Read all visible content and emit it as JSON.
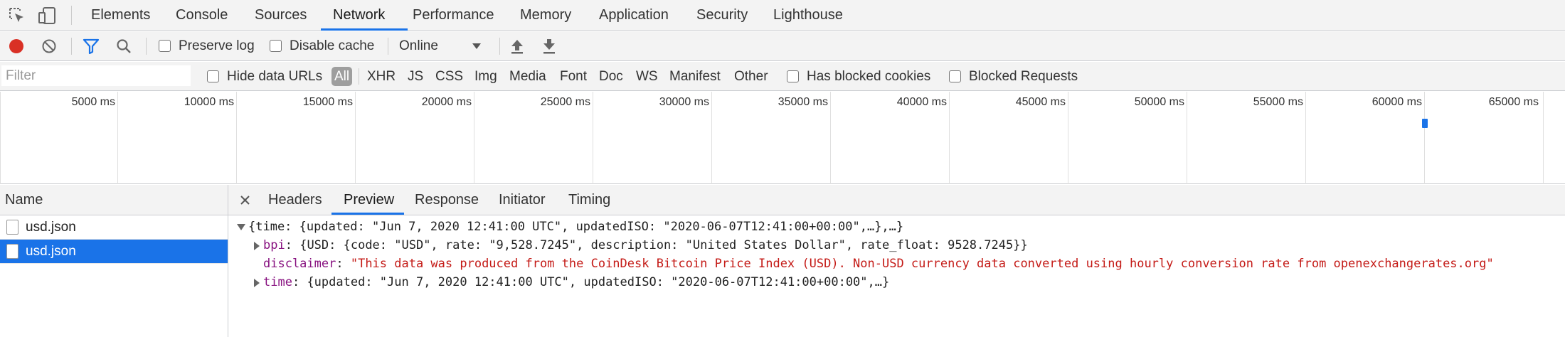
{
  "main_tabs": [
    "Elements",
    "Console",
    "Sources",
    "Network",
    "Performance",
    "Memory",
    "Application",
    "Security",
    "Lighthouse"
  ],
  "active_main_tab": "Network",
  "toolbar": {
    "preserve_log": "Preserve log",
    "disable_cache": "Disable cache",
    "throttling": "Online"
  },
  "filter": {
    "placeholder": "Filter",
    "hide_data_urls": "Hide data URLs",
    "types": [
      "All",
      "XHR",
      "JS",
      "CSS",
      "Img",
      "Media",
      "Font",
      "Doc",
      "WS",
      "Manifest",
      "Other"
    ],
    "active_type": "All",
    "has_blocked_cookies": "Has blocked cookies",
    "blocked_requests": "Blocked Requests"
  },
  "timeline": {
    "ticks": [
      "5000 ms",
      "10000 ms",
      "15000 ms",
      "20000 ms",
      "25000 ms",
      "30000 ms",
      "35000 ms",
      "40000 ms",
      "45000 ms",
      "50000 ms",
      "55000 ms",
      "60000 ms",
      "65000 ms"
    ]
  },
  "requests": {
    "header": "Name",
    "rows": [
      "usd.json",
      "usd.json"
    ],
    "selected_index": 1
  },
  "detail_tabs": [
    "Headers",
    "Preview",
    "Response",
    "Initiator",
    "Timing"
  ],
  "active_detail_tab": "Preview",
  "preview": {
    "root": "{time: {updated: \"Jun 7, 2020 12:41:00 UTC\", updatedISO: \"2020-06-07T12:41:00+00:00\",…},…}",
    "bpi_key": "bpi",
    "bpi_value": "{USD: {code: \"USD\", rate: \"9,528.7245\", description: \"United States Dollar\", rate_float: 9528.7245}}",
    "disclaimer_key": "disclaimer",
    "disclaimer_value": "\"This data was produced from the CoinDesk Bitcoin Price Index (USD). Non-USD currency data converted using hourly conversion rate from openexchangerates.org\"",
    "time_key": "time",
    "time_value": "{updated: \"Jun 7, 2020 12:41:00 UTC\", updatedISO: \"2020-06-07T12:41:00+00:00\",…}"
  },
  "colors": {
    "accent": "#1a73e8",
    "record": "#d93025",
    "key": "#881280",
    "string": "#c41a16"
  }
}
